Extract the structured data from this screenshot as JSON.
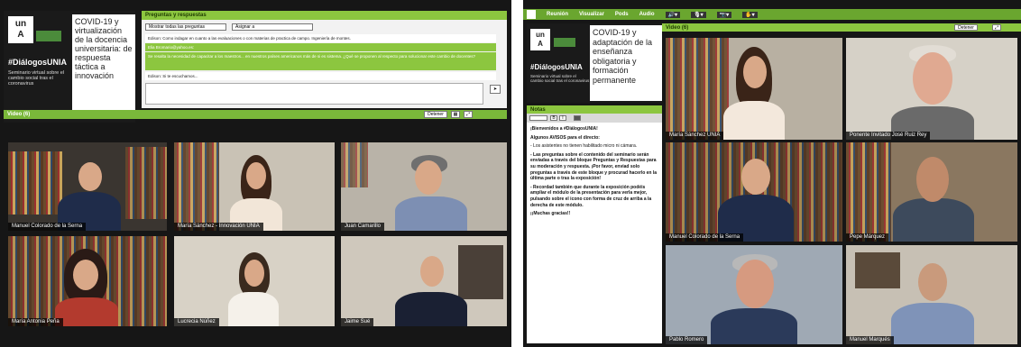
{
  "left": {
    "banner": {
      "logo": "un",
      "logo2": "A",
      "tag": "#DiálogosUNIA",
      "sub": "Seminario virtual sobre el cambio social tras el coronavirus",
      "title": "COVID-19 y virtualización de la docencia universitaria: de respuesta táctica a innovación"
    },
    "qa": {
      "title": "Preguntas y respuestas",
      "filter1": "Mostrar todas las preguntas",
      "filter2": "Asignar a",
      "rows": [
        "Edison: Como indagar en cuanto a las evaluaciones o con materias de practica de campo. Ingeniería de montes.",
        "Elia Bromario@yahoo.es:",
        "Se resalta la necesidad de capacitar a los maestros... en nuestros países americanos más de si es sistema. ¿Qué se proponen al respecto para solucionar este cambio de docentes?",
        "Edison: Si te escuchamos..."
      ]
    },
    "video": {
      "title": "Video  (6)",
      "btn": "Detener"
    },
    "tiles": [
      "Manuel Colorado de la Serna",
      "María Sánchez - Innovación UNIA",
      "Juan Camarillo",
      "María Antonia Peña",
      "Lucrecia Núñez",
      "Jaime Sué"
    ]
  },
  "right": {
    "menu": [
      "Reunión",
      "Visualizar",
      "Pods",
      "Audio"
    ],
    "banner": {
      "logo": "un",
      "logo2": "A",
      "tag": "#DiálogosUNIA",
      "sub": "Seminario virtual sobre el cambio social tras el coronavirus",
      "title": "COVID-19 y adaptación de la enseñanza obligatoria y formación permanente"
    },
    "video": {
      "title": "Video  (6)",
      "btn": "Detener"
    },
    "notes": {
      "title": "Notas",
      "lines": [
        "¡Bienvenidos a #DiálogosUNIA!",
        "Algunos AVISOS para el directo:",
        "- Los asistentes no tienen habilitado micro ni cámara.",
        "- Las preguntas sobre el contenido del seminario serán enviadas a través del bloque Preguntas y Respuestas para su moderación y respuesta. ¡Por favor, enviad solo preguntas a través de este bloque y procurad hacerlo en la última parte o tras la exposición!",
        "- Recordad también que durante la exposición podéis ampliar el módulo de la presentación para verla mejor, pulsando sobre el icono con forma de cruz de arriba a la derecha de este módulo.",
        "¡¡Muchas gracias!!"
      ]
    },
    "tiles": [
      "María Sánchez UNIA",
      "Ponente Invitado José Ruiz Rey",
      "Manuel Colorado de la Serna",
      "Pepe Márquez",
      "Pablo Romero",
      "Manuel Marqués"
    ]
  }
}
